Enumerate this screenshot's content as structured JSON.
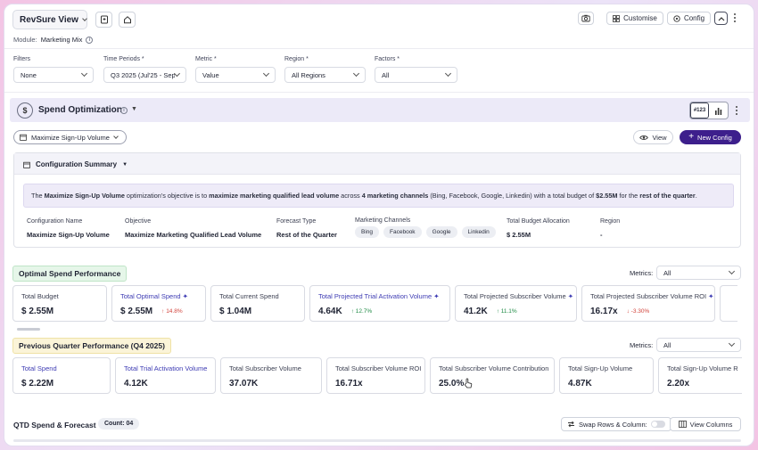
{
  "header": {
    "view_name": "RevSure View",
    "module_label": "Module:",
    "module_value": "Marketing Mix",
    "customise_label": "Customise",
    "config_label": "Config"
  },
  "filters": [
    {
      "label": "Filters",
      "value": "None"
    },
    {
      "label": "Time Periods *",
      "value": "Q3 2025 (Jul'25 - Sep..."
    },
    {
      "label": "Metric *",
      "value": "Value"
    },
    {
      "label": "Region *",
      "value": "All Regions"
    },
    {
      "label": "Factors *",
      "value": "All"
    }
  ],
  "spend": {
    "title": "Spend Optimization",
    "toggle_number": "#123",
    "scenario": "Maximize Sign-Up Volume",
    "view_label": "View",
    "new_config_label": "New Config"
  },
  "config_summary": {
    "title": "Configuration Summary",
    "banner": {
      "p1": "The ",
      "b1": "Maximize Sign-Up Volume",
      "p2": " optimization's objective is to ",
      "b2": "maximize marketing qualified lead volume",
      "p3": " across ",
      "b3": "4 marketing channels",
      "p4": " (Bing, Facebook, Google, Linkedin) with a total budget of ",
      "b4": "$2.55M",
      "p5": " for the ",
      "b5": "rest of the quarter",
      "p6": "."
    },
    "fields": {
      "config_name_label": "Configuration Name",
      "config_name": "Maximize Sign-Up Volume",
      "objective_label": "Objective",
      "objective": "Maximize Marketing Qualified Lead Volume",
      "forecast_label": "Forecast Type",
      "forecast": "Rest of the Quarter",
      "channels_label": "Marketing Channels",
      "channels": [
        "Bing",
        "Facebook",
        "Google",
        "Linkedin"
      ],
      "budget_label": "Total Budget Allocation",
      "budget": "$ 2.55M",
      "region_label": "Region",
      "region": "-"
    }
  },
  "optimal": {
    "title": "Optimal Spend Performance",
    "metrics_label": "Metrics:",
    "metrics_value": "All",
    "cards": [
      {
        "label": "Total Budget",
        "value": "$ 2.55M",
        "change": "",
        "highlight": false
      },
      {
        "label": "Total Optimal Spend",
        "value": "$ 2.55M",
        "change": "↑ 14.8%",
        "highlight": true
      },
      {
        "label": "Total Current Spend",
        "value": "$ 1.04M",
        "change": "",
        "highlight": false
      },
      {
        "label": "Total Projected Trial Activation Volume",
        "value": "4.64K",
        "change": "↑ 12.7%",
        "highlight": true
      },
      {
        "label": "Total Projected Subscriber Volume",
        "value": "41.2K",
        "change": "↑ 11.1%",
        "highlight": false
      },
      {
        "label": "Total Projected Subscriber Volume ROI",
        "value": "16.17x",
        "change": "↓ -3.30%",
        "highlight": false
      }
    ]
  },
  "previous": {
    "title": "Previous Quarter Performance (Q4 2025)",
    "metrics_label": "Metrics:",
    "metrics_value": "All",
    "cards": [
      {
        "label": "Total Spend",
        "value": "$ 2.22M",
        "highlight": true
      },
      {
        "label": "Total Trial Activation Volume",
        "value": "4.12K",
        "highlight": true
      },
      {
        "label": "Total Subscriber Volume",
        "value": "37.07K",
        "highlight": false
      },
      {
        "label": "Total Subscriber Volume ROI",
        "value": "16.71x",
        "highlight": false
      },
      {
        "label": "Total Subscriber Volume Contribution",
        "value": "25.0%",
        "highlight": false
      },
      {
        "label": "Total Sign-Up Volume",
        "value": "4.87K",
        "highlight": false
      },
      {
        "label": "Total Sign-Up Volume R",
        "value": "2.20x",
        "highlight": false
      }
    ]
  },
  "qtd": {
    "title": "QTD Spend & Forecast",
    "count": "Count: 04",
    "swap_label": "Swap Rows & Column:",
    "view_columns_label": "View Columns"
  },
  "colors": {
    "accent": "#3d1f8c",
    "highlight_text": "#3d3bb3",
    "green_badge": "#e6f6e9",
    "yellow_badge": "#fbf4d8"
  }
}
